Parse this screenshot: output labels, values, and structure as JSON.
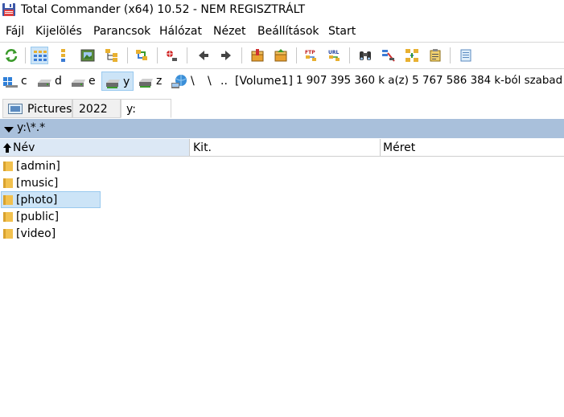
{
  "window": {
    "title": "Total Commander (x64) 10.52 - NEM REGISZTRÁLT"
  },
  "menu": [
    {
      "label": "Fájl"
    },
    {
      "label": "Kijelölés"
    },
    {
      "label": "Parancsok"
    },
    {
      "label": "Hálózat"
    },
    {
      "label": "Nézet"
    },
    {
      "label": "Beállítások"
    },
    {
      "label": "Start"
    }
  ],
  "toolbar": {
    "buttons": [
      {
        "icon": "refresh-icon"
      },
      {
        "icon": "brief-view-icon",
        "active": true
      },
      {
        "icon": "detailed-view-icon"
      },
      {
        "icon": "thumbnails-icon"
      },
      {
        "icon": "tree-view-icon"
      },
      {
        "icon": "compare-dirs-icon"
      },
      {
        "icon": "invert-selection-icon"
      },
      {
        "icon": "back-icon"
      },
      {
        "icon": "forward-icon"
      },
      {
        "icon": "pack-icon"
      },
      {
        "icon": "unpack-icon"
      },
      {
        "icon": "ftp-icon",
        "text": "FTP"
      },
      {
        "icon": "url-icon",
        "text": "URL"
      },
      {
        "icon": "find-icon"
      },
      {
        "icon": "multi-rename-icon"
      },
      {
        "icon": "sync-dirs-icon"
      },
      {
        "icon": "copy-names-icon"
      },
      {
        "icon": "notepad-icon"
      }
    ]
  },
  "drives": [
    {
      "letter": "c",
      "icon": "windows-drive-icon",
      "active": false
    },
    {
      "letter": "d",
      "icon": "hard-drive-icon",
      "active": false
    },
    {
      "letter": "e",
      "icon": "hard-drive-icon",
      "active": false
    },
    {
      "letter": "y",
      "icon": "network-drive-icon",
      "active": true
    },
    {
      "letter": "z",
      "icon": "network-drive-icon",
      "active": false
    }
  ],
  "drive_info": {
    "root": "\\",
    "parent": "..",
    "volume": "[Volume1]",
    "space": "1 907 395 360 k a(z) 5 767 586 384 k-ból szabad"
  },
  "tabs": [
    {
      "label": "Pictures",
      "icon": "picture-folder-icon",
      "active": false
    },
    {
      "label": "2022",
      "active": false
    },
    {
      "label": "y:",
      "active": true
    }
  ],
  "path": "y:\\*.*",
  "columns": {
    "name": "Név",
    "ext": "Kit.",
    "size": "Méret"
  },
  "files": [
    {
      "name": "[admin]",
      "selected": false
    },
    {
      "name": "[music]",
      "selected": false
    },
    {
      "name": "[photo]",
      "selected": true
    },
    {
      "name": "[public]",
      "selected": false
    },
    {
      "name": "[video]",
      "selected": false
    }
  ],
  "colors": {
    "path_bar": "#a9c0db",
    "selection": "#cce4f7",
    "selection_border": "#99c9ef",
    "folder": "#f2c14e"
  }
}
